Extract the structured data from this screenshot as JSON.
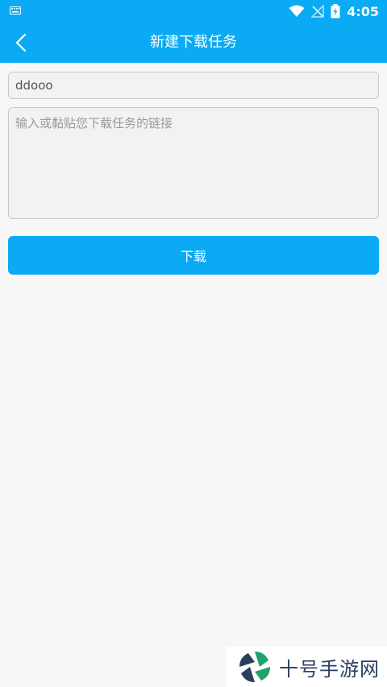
{
  "status_bar": {
    "time": "4:05",
    "icons": [
      "keyboard-icon",
      "wifi-icon",
      "no-signal-icon",
      "battery-icon"
    ]
  },
  "header": {
    "title": "新建下载任务",
    "back_icon": "chevron-left-icon"
  },
  "form": {
    "name_value": "ddooo",
    "url_placeholder": "输入或黏贴您下载任务的链接",
    "download_label": "下载"
  },
  "watermark": {
    "text": "十号手游网"
  },
  "colors": {
    "accent": "#0aaaf4",
    "background": "#f7f7f7"
  }
}
